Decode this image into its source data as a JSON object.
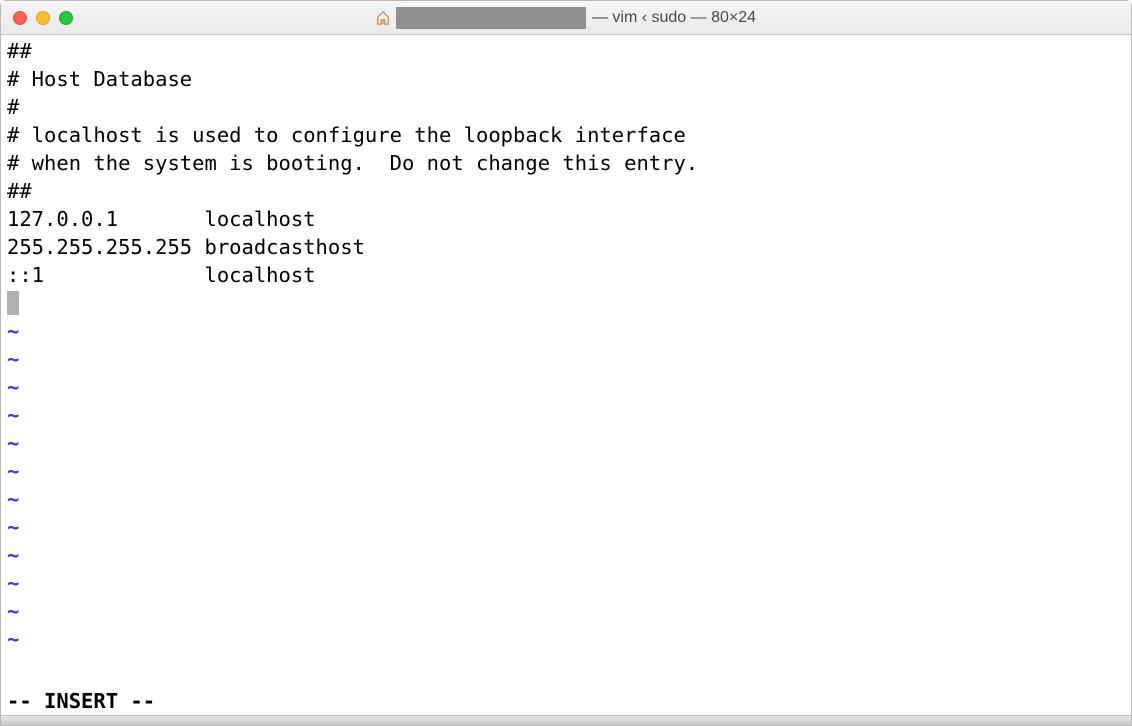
{
  "titlebar": {
    "title_suffix": "— vim ‹ sudo — 80×24"
  },
  "editor": {
    "lines": [
      "##",
      "# Host Database",
      "#",
      "# localhost is used to configure the loopback interface",
      "# when the system is booting.  Do not change this entry.",
      "##",
      "127.0.0.1       localhost",
      "255.255.255.255 broadcasthost",
      "::1             localhost"
    ],
    "tilde": "~",
    "tilde_count": 12
  },
  "status": {
    "mode": "-- INSERT --"
  }
}
